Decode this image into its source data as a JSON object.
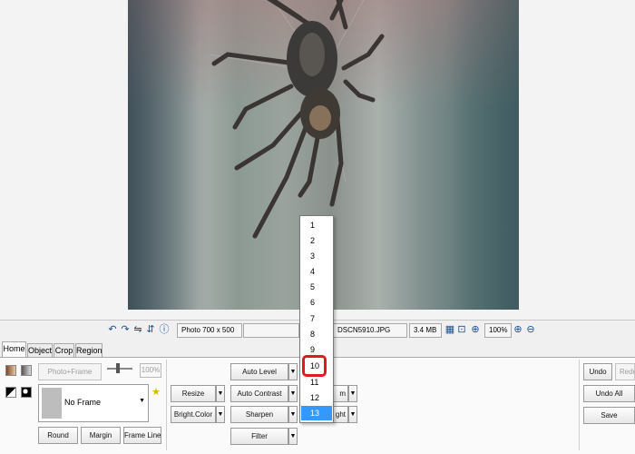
{
  "status_bar": {
    "dimensions": "Photo 700 x 500",
    "filename": "DSCN5910.JPG",
    "filesize": "3.4 MB",
    "zoom": "100%"
  },
  "tabs": [
    {
      "label": "Home",
      "active": true
    },
    {
      "label": "Object",
      "active": false
    },
    {
      "label": "Crop",
      "active": false
    },
    {
      "label": "Region",
      "active": false
    }
  ],
  "frame": {
    "photo_frame_label": "Photo+Frame",
    "zoom_value": "100%",
    "selected_frame": "No Frame",
    "round_label": "Round",
    "margin_label": "Margin",
    "frame_line_label": "Frame Line"
  },
  "adjust": {
    "resize_label": "Resize",
    "bright_color_label": "Bright.Color",
    "auto_level_label": "Auto Level",
    "auto_contrast_label": "Auto Contrast",
    "sharpen_label": "Sharpen",
    "filter_label": "Filter",
    "partial_right_1": "m",
    "partial_right_2": "ght"
  },
  "history": {
    "undo_label": "Undo",
    "redo_label": "Redo",
    "undo_all_label": "Undo All",
    "save_label": "Save"
  },
  "sharpen_dropdown": {
    "options": [
      "1",
      "2",
      "3",
      "4",
      "5",
      "6",
      "7",
      "8",
      "9",
      "10",
      "11",
      "12",
      "13"
    ],
    "selected": "13",
    "highlighted": "10"
  },
  "colors": {
    "selection": "#3399ff",
    "highlight_ring": "#e01a22"
  }
}
